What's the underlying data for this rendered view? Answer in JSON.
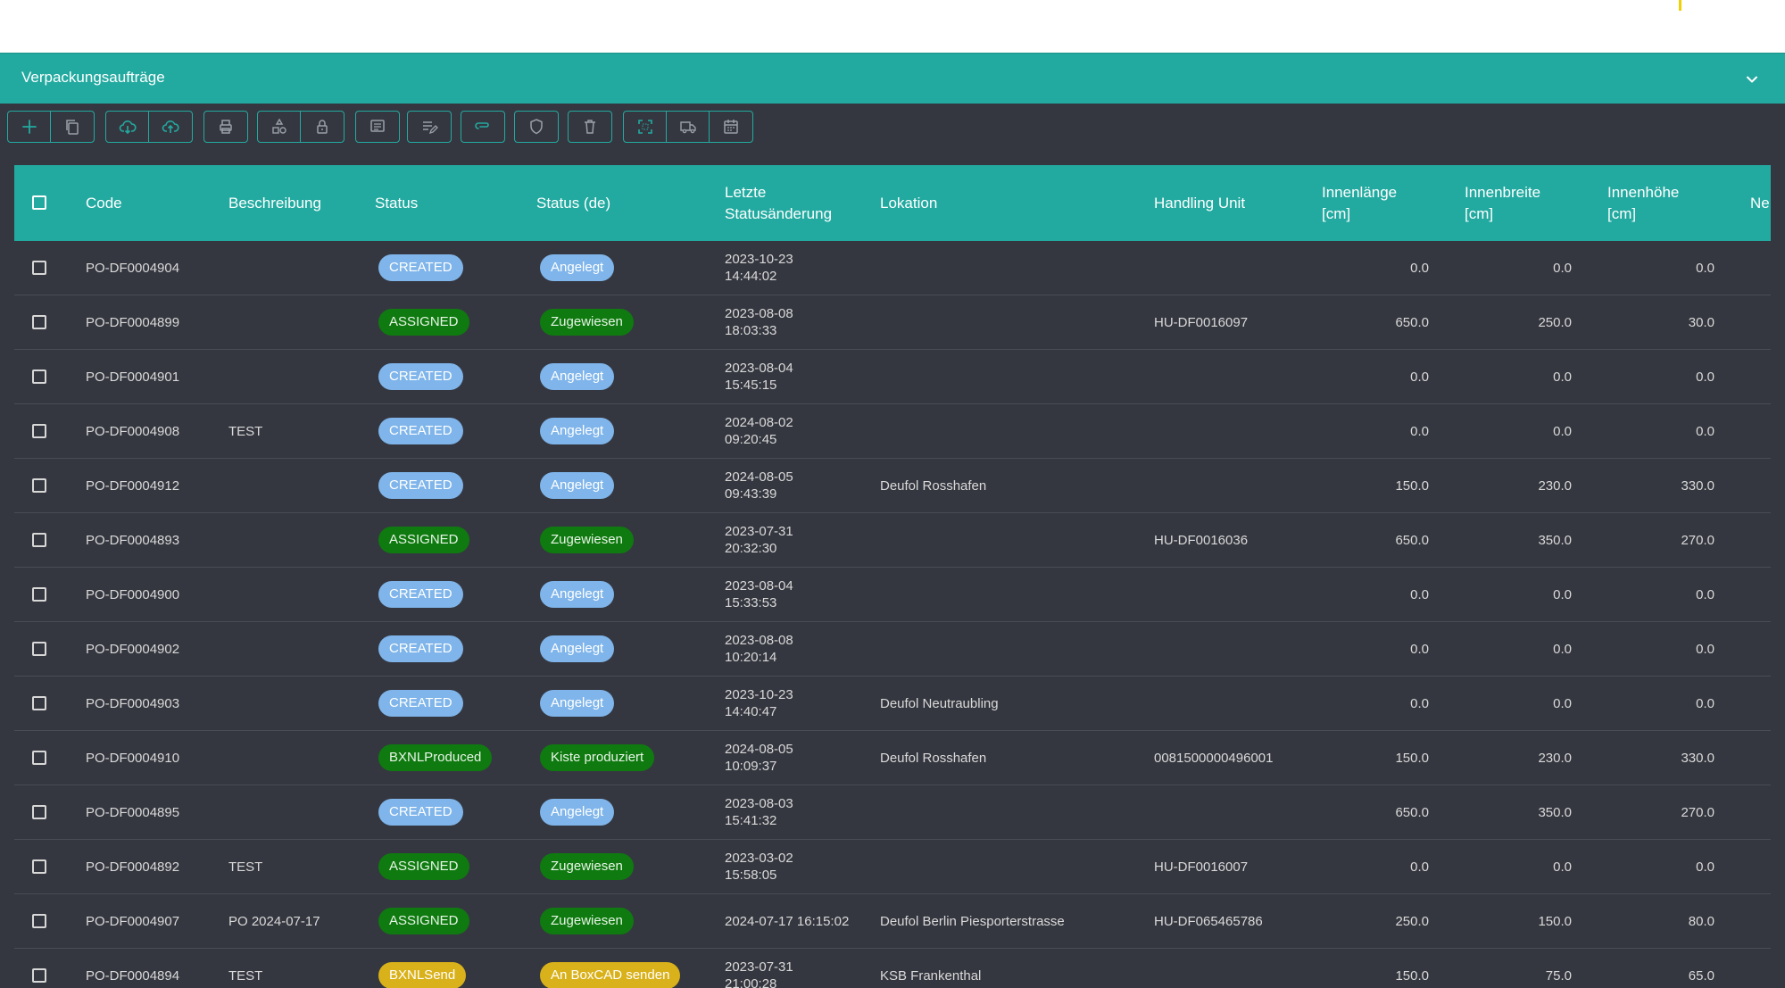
{
  "panel": {
    "title": "Verpackungsaufträge"
  },
  "toolbar": {
    "groups": [
      [
        "plus-icon",
        "copy-icon"
      ],
      [
        "cloud-download-icon",
        "cloud-upload-icon"
      ],
      [
        "print-icon"
      ],
      [
        "shapes-icon",
        "lock-icon"
      ],
      [
        "comment-icon"
      ],
      [
        "edit-list-icon"
      ],
      [
        "attachment-icon"
      ],
      [
        "shield-icon"
      ],
      [
        "trash-icon"
      ],
      [
        "scan-frame-icon",
        "truck-icon",
        "calendar-icon"
      ]
    ]
  },
  "columns": {
    "code": "Code",
    "beschreibung": "Beschreibung",
    "status": "Status",
    "status_de": "Status (de)",
    "letzte_line1": "Letzte",
    "letzte_line2": "Statusänderung",
    "lokation": "Lokation",
    "handling_unit": "Handling Unit",
    "innenlaenge_line1": "Innenlänge",
    "innenlaenge_line2": "[cm]",
    "innenbreite_line1": "Innenbreite",
    "innenbreite_line2": "[cm]",
    "innenhoehe_line1": "Innenhöhe",
    "innenhoehe_line2": "[cm]",
    "next_partial": "Ne"
  },
  "status_colors": {
    "CREATED": {
      "bg": "#7fb5ea",
      "fg": "#ffffff"
    },
    "ASSIGNED": {
      "bg": "#0f7a0f",
      "fg": "#e8f5e8"
    },
    "BXNLProduced": {
      "bg": "#0f7a0f",
      "fg": "#e8f5e8"
    },
    "BXNLSend": {
      "bg": "#d9b11a",
      "fg": "#ffffff"
    }
  },
  "rows": [
    {
      "code": "PO-DF0004904",
      "beschreibung": "",
      "status": "CREATED",
      "status_de": "Angelegt",
      "date": "2023-10-23",
      "time": "14:44:02",
      "lokation": "",
      "handling_unit": "",
      "laenge": "0.0",
      "breite": "0.0",
      "hoehe": "0.0"
    },
    {
      "code": "PO-DF0004899",
      "beschreibung": "",
      "status": "ASSIGNED",
      "status_de": "Zugewiesen",
      "date": "2023-08-08",
      "time": "18:03:33",
      "lokation": "",
      "handling_unit": "HU-DF0016097",
      "laenge": "650.0",
      "breite": "250.0",
      "hoehe": "30.0"
    },
    {
      "code": "PO-DF0004901",
      "beschreibung": "",
      "status": "CREATED",
      "status_de": "Angelegt",
      "date": "2023-08-04",
      "time": "15:45:15",
      "lokation": "",
      "handling_unit": "",
      "laenge": "0.0",
      "breite": "0.0",
      "hoehe": "0.0"
    },
    {
      "code": "PO-DF0004908",
      "beschreibung": "TEST",
      "status": "CREATED",
      "status_de": "Angelegt",
      "date": "2024-08-02",
      "time": "09:20:45",
      "lokation": "",
      "handling_unit": "",
      "laenge": "0.0",
      "breite": "0.0",
      "hoehe": "0.0"
    },
    {
      "code": "PO-DF0004912",
      "beschreibung": "",
      "status": "CREATED",
      "status_de": "Angelegt",
      "date": "2024-08-05",
      "time": "09:43:39",
      "lokation": "Deufol Rosshafen",
      "handling_unit": "",
      "laenge": "150.0",
      "breite": "230.0",
      "hoehe": "330.0"
    },
    {
      "code": "PO-DF0004893",
      "beschreibung": "",
      "status": "ASSIGNED",
      "status_de": "Zugewiesen",
      "date": "2023-07-31",
      "time": "20:32:30",
      "lokation": "",
      "handling_unit": "HU-DF0016036",
      "laenge": "650.0",
      "breite": "350.0",
      "hoehe": "270.0"
    },
    {
      "code": "PO-DF0004900",
      "beschreibung": "",
      "status": "CREATED",
      "status_de": "Angelegt",
      "date": "2023-08-04",
      "time": "15:33:53",
      "lokation": "",
      "handling_unit": "",
      "laenge": "0.0",
      "breite": "0.0",
      "hoehe": "0.0"
    },
    {
      "code": "PO-DF0004902",
      "beschreibung": "",
      "status": "CREATED",
      "status_de": "Angelegt",
      "date": "2023-08-08",
      "time": "10:20:14",
      "lokation": "",
      "handling_unit": "",
      "laenge": "0.0",
      "breite": "0.0",
      "hoehe": "0.0"
    },
    {
      "code": "PO-DF0004903",
      "beschreibung": "",
      "status": "CREATED",
      "status_de": "Angelegt",
      "date": "2023-10-23",
      "time": "14:40:47",
      "lokation": "Deufol Neutraubling",
      "handling_unit": "",
      "laenge": "0.0",
      "breite": "0.0",
      "hoehe": "0.0"
    },
    {
      "code": "PO-DF0004910",
      "beschreibung": "",
      "status": "BXNLProduced",
      "status_de": "Kiste produziert",
      "date": "2024-08-05",
      "time": "10:09:37",
      "lokation": "Deufol Rosshafen",
      "handling_unit": "0081500000496001",
      "laenge": "150.0",
      "breite": "230.0",
      "hoehe": "330.0"
    },
    {
      "code": "PO-DF0004895",
      "beschreibung": "",
      "status": "CREATED",
      "status_de": "Angelegt",
      "date": "2023-08-03",
      "time": "15:41:32",
      "lokation": "",
      "handling_unit": "",
      "laenge": "650.0",
      "breite": "350.0",
      "hoehe": "270.0"
    },
    {
      "code": "PO-DF0004892",
      "beschreibung": "TEST",
      "status": "ASSIGNED",
      "status_de": "Zugewiesen",
      "date": "2023-03-02",
      "time": "15:58:05",
      "lokation": "",
      "handling_unit": "HU-DF0016007",
      "laenge": "0.0",
      "breite": "0.0",
      "hoehe": "0.0"
    },
    {
      "code": "PO-DF0004907",
      "beschreibung": "PO 2024-07-17",
      "status": "ASSIGNED",
      "status_de": "Zugewiesen",
      "date": "2024-07-17 16:15:02",
      "time": "",
      "lokation": "Deufol Berlin Piesporterstrasse",
      "handling_unit": "HU-DF065465786",
      "laenge": "250.0",
      "breite": "150.0",
      "hoehe": "80.0"
    },
    {
      "code": "PO-DF0004894",
      "beschreibung": "TEST",
      "status": "BXNLSend",
      "status_de": "An BoxCAD senden",
      "date": "2023-07-31",
      "time": "21:00:28",
      "lokation": "KSB Frankenthal",
      "handling_unit": "",
      "laenge": "150.0",
      "breite": "75.0",
      "hoehe": "65.0"
    }
  ]
}
